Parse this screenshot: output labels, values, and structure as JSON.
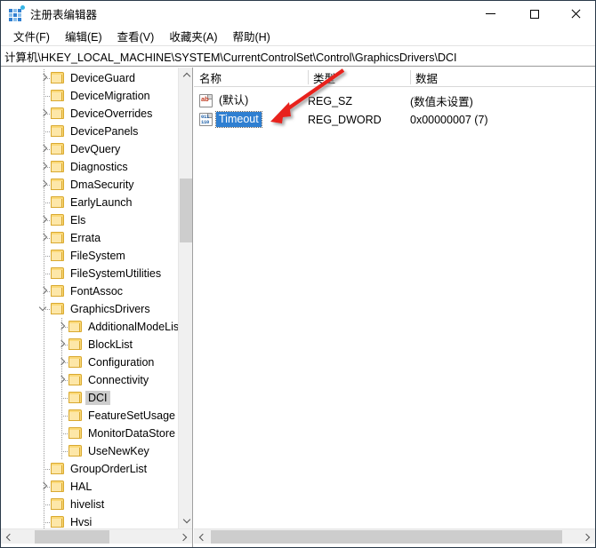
{
  "window": {
    "title": "注册表编辑器",
    "icon": "registry-editor-icon",
    "controls": {
      "minimize": "—",
      "maximize": "□",
      "close": "✕"
    }
  },
  "menu": {
    "items": [
      {
        "label": "文件(F)"
      },
      {
        "label": "编辑(E)"
      },
      {
        "label": "查看(V)"
      },
      {
        "label": "收藏夹(A)"
      },
      {
        "label": "帮助(H)"
      }
    ]
  },
  "address": {
    "path": "计算机\\HKEY_LOCAL_MACHINE\\SYSTEM\\CurrentControlSet\\Control\\GraphicsDrivers\\DCI"
  },
  "tree": {
    "items": [
      {
        "label": "DeviceGuard",
        "depth": 1,
        "expandable": true,
        "expanded": false,
        "selected": false
      },
      {
        "label": "DeviceMigration",
        "depth": 1,
        "expandable": false,
        "expanded": false,
        "selected": false
      },
      {
        "label": "DeviceOverrides",
        "depth": 1,
        "expandable": true,
        "expanded": false,
        "selected": false
      },
      {
        "label": "DevicePanels",
        "depth": 1,
        "expandable": false,
        "expanded": false,
        "selected": false
      },
      {
        "label": "DevQuery",
        "depth": 1,
        "expandable": true,
        "expanded": false,
        "selected": false
      },
      {
        "label": "Diagnostics",
        "depth": 1,
        "expandable": true,
        "expanded": false,
        "selected": false
      },
      {
        "label": "DmaSecurity",
        "depth": 1,
        "expandable": true,
        "expanded": false,
        "selected": false
      },
      {
        "label": "EarlyLaunch",
        "depth": 1,
        "expandable": false,
        "expanded": false,
        "selected": false
      },
      {
        "label": "Els",
        "depth": 1,
        "expandable": true,
        "expanded": false,
        "selected": false
      },
      {
        "label": "Errata",
        "depth": 1,
        "expandable": true,
        "expanded": false,
        "selected": false
      },
      {
        "label": "FileSystem",
        "depth": 1,
        "expandable": false,
        "expanded": false,
        "selected": false
      },
      {
        "label": "FileSystemUtilities",
        "depth": 1,
        "expandable": false,
        "expanded": false,
        "selected": false
      },
      {
        "label": "FontAssoc",
        "depth": 1,
        "expandable": true,
        "expanded": false,
        "selected": false
      },
      {
        "label": "GraphicsDrivers",
        "depth": 1,
        "expandable": true,
        "expanded": true,
        "selected": false
      },
      {
        "label": "AdditionalModeLis",
        "depth": 2,
        "expandable": true,
        "expanded": false,
        "selected": false
      },
      {
        "label": "BlockList",
        "depth": 2,
        "expandable": true,
        "expanded": false,
        "selected": false
      },
      {
        "label": "Configuration",
        "depth": 2,
        "expandable": true,
        "expanded": false,
        "selected": false
      },
      {
        "label": "Connectivity",
        "depth": 2,
        "expandable": true,
        "expanded": false,
        "selected": false
      },
      {
        "label": "DCI",
        "depth": 2,
        "expandable": false,
        "expanded": false,
        "selected": true
      },
      {
        "label": "FeatureSetUsage",
        "depth": 2,
        "expandable": false,
        "expanded": false,
        "selected": false
      },
      {
        "label": "MonitorDataStore",
        "depth": 2,
        "expandable": false,
        "expanded": false,
        "selected": false
      },
      {
        "label": "UseNewKey",
        "depth": 2,
        "expandable": false,
        "expanded": false,
        "selected": false
      },
      {
        "label": "GroupOrderList",
        "depth": 1,
        "expandable": false,
        "expanded": false,
        "selected": false
      },
      {
        "label": "HAL",
        "depth": 1,
        "expandable": true,
        "expanded": false,
        "selected": false
      },
      {
        "label": "hivelist",
        "depth": 1,
        "expandable": false,
        "expanded": false,
        "selected": false
      },
      {
        "label": "Hvsi",
        "depth": 1,
        "expandable": false,
        "expanded": false,
        "selected": false
      }
    ]
  },
  "values": {
    "columns": [
      {
        "label": "名称"
      },
      {
        "label": "类型"
      },
      {
        "label": "数据"
      }
    ],
    "rows": [
      {
        "name": "(默认)",
        "type": "REG_SZ",
        "data": "(数值未设置)",
        "icon": "string-value-icon",
        "selected": false
      },
      {
        "name": "Timeout",
        "type": "REG_DWORD",
        "data": "0x00000007 (7)",
        "icon": "dword-value-icon",
        "selected": true
      }
    ]
  },
  "annotation": {
    "arrow_color": "#e8201c",
    "points_to": "Timeout"
  },
  "colors": {
    "selection_blue": "#2f7fd1",
    "tree_selection_gray": "#cdcdcd",
    "folder_yellow": "#fbd978",
    "scrollbar_thumb": "#cdcdcd"
  }
}
